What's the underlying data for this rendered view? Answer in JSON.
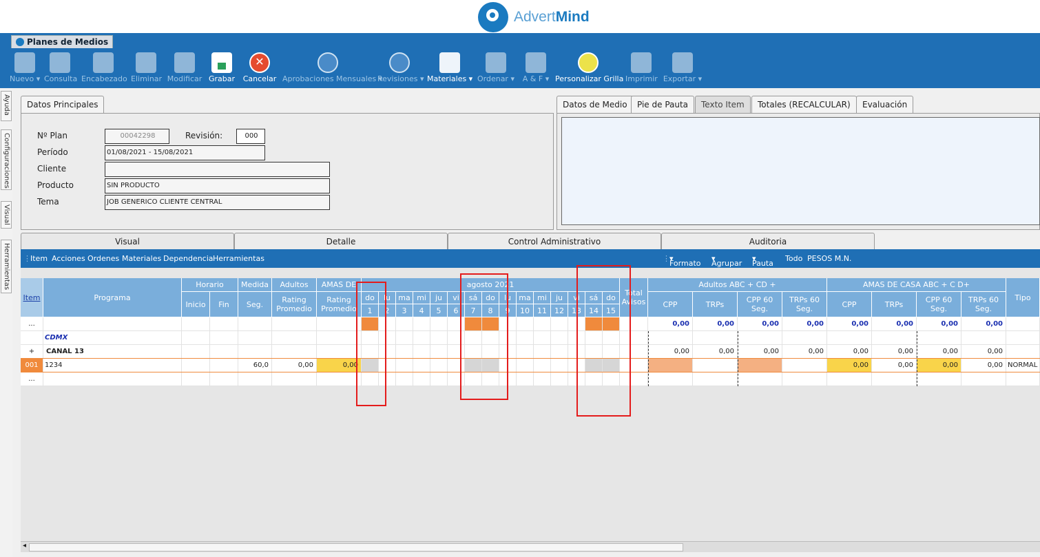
{
  "brand": {
    "name_light": "Advert",
    "name_bold": "Mind"
  },
  "module_tab": "Planes de Medios",
  "toolbar": [
    {
      "label": "Nuevo",
      "dropdown": true,
      "enabled": false,
      "icon": "new-doc-icon"
    },
    {
      "label": "Consulta",
      "dropdown": false,
      "enabled": false,
      "icon": "query-doc-icon"
    },
    {
      "label": "Encabezado",
      "dropdown": false,
      "enabled": false,
      "icon": "edit-doc-icon"
    },
    {
      "label": "Eliminar",
      "dropdown": false,
      "enabled": false,
      "icon": "delete-doc-icon"
    },
    {
      "label": "Modificar",
      "dropdown": false,
      "enabled": false,
      "icon": "modify-doc-icon"
    },
    {
      "label": "Grabar",
      "dropdown": false,
      "enabled": true,
      "icon": "save-icon"
    },
    {
      "label": "Cancelar",
      "dropdown": false,
      "enabled": true,
      "icon": "cancel-icon"
    },
    {
      "label": "Aprobaciones Mensuales",
      "dropdown": true,
      "enabled": false,
      "icon": "thumbs-up-icon"
    },
    {
      "label": "Revisiones",
      "dropdown": true,
      "enabled": false,
      "icon": "thumbs-up-icon"
    },
    {
      "label": "Materiales",
      "dropdown": true,
      "enabled": true,
      "icon": "materials-icon"
    },
    {
      "label": "Ordenar",
      "dropdown": true,
      "enabled": false,
      "icon": "order-doc-icon"
    },
    {
      "label": "A & F",
      "dropdown": true,
      "enabled": false,
      "icon": "af-doc-icon"
    },
    {
      "label": "Personalizar Grilla",
      "dropdown": false,
      "enabled": true,
      "icon": "grid-icon"
    },
    {
      "label": "Imprimir",
      "dropdown": false,
      "enabled": false,
      "icon": "printer-icon"
    },
    {
      "label": "Exportar",
      "dropdown": true,
      "enabled": false,
      "icon": "export-icon"
    }
  ],
  "side_tabs": [
    "Ayuda",
    "Configuraciones",
    "Visual",
    "Herramientas"
  ],
  "datos_principales": {
    "title": "Datos Principales",
    "plan_label": "Nº Plan",
    "plan_value": "00042298",
    "revision_label": "Revisión:",
    "revision_value": "000",
    "periodo_label": "Período",
    "periodo_value": "01/08/2021 - 15/08/2021",
    "cliente_label": "Cliente",
    "cliente_value": "",
    "producto_label": "Producto",
    "producto_value": "SIN PRODUCTO",
    "tema_label": "Tema",
    "tema_value": "JOB GENERICO CLIENTE CENTRAL"
  },
  "right_tabs": [
    "Datos de Medio",
    "Pie de Pauta",
    "Texto Item",
    "Totales (RECALCULAR)",
    "Evaluación"
  ],
  "lower_tabs": [
    "Visual",
    "Detalle",
    "Control Administrativo",
    "Auditoria"
  ],
  "grid_menu_left": [
    "Item",
    "Acciones",
    "Ordenes",
    "Materiales",
    "Dependencia",
    "Herramientas"
  ],
  "grid_menu_right": [
    "Formato",
    "Agrupar",
    "Pauta",
    "Todo",
    "PESOS M.N."
  ],
  "grid": {
    "item_header": "Item",
    "programa_header": "Programa",
    "horario_header": "Horario",
    "inicio_header": "Inicio",
    "fin_header": "Fin",
    "medida_header": "Medida",
    "seg_header": "Seg.",
    "adultos_header": "Adultos",
    "rating_header": "Rating Promedio",
    "amas_header": "AMAS DE",
    "rating2_header": "Rating Promedio",
    "month_header": "agosto 2021",
    "days": [
      {
        "dow": "do",
        "num": "1"
      },
      {
        "dow": "lu",
        "num": "2"
      },
      {
        "dow": "ma",
        "num": "3"
      },
      {
        "dow": "mi",
        "num": "4"
      },
      {
        "dow": "ju",
        "num": "5"
      },
      {
        "dow": "vi",
        "num": "6"
      },
      {
        "dow": "sá",
        "num": "7"
      },
      {
        "dow": "do",
        "num": "8"
      },
      {
        "dow": "lu",
        "num": "9"
      },
      {
        "dow": "ma",
        "num": "10"
      },
      {
        "dow": "mi",
        "num": "11"
      },
      {
        "dow": "ju",
        "num": "12"
      },
      {
        "dow": "vi",
        "num": "13"
      },
      {
        "dow": "sá",
        "num": "14"
      },
      {
        "dow": "do",
        "num": "15"
      }
    ],
    "total_avisos_header": "Total Avisos",
    "group1_header": "Adultos ABC + CD +",
    "group2_header": "AMAS DE CASA ABC + C D+",
    "metric_headers": [
      "CPP",
      "TRPs",
      "CPP 60 Seg.",
      "TRPs 60 Seg."
    ],
    "tipo_header": "Tipo",
    "rows": {
      "summary": {
        "item": "...",
        "metrics": [
          "0,00",
          "0,00",
          "0,00",
          "0,00",
          "0,00",
          "0,00",
          "0,00",
          "0,00"
        ]
      },
      "group": {
        "label": "CDMX"
      },
      "channel": {
        "expander": "+",
        "label": "CANAL 13",
        "metrics": [
          "0,00",
          "0,00",
          "0,00",
          "0,00",
          "0,00",
          "0,00",
          "0,00",
          "0,00"
        ]
      },
      "item": {
        "item": "001",
        "programa": "1234",
        "seg": "60,0",
        "rating": "0,00",
        "rating2": "0,00",
        "metrics": [
          "",
          "",
          "",
          "",
          "0,00",
          "0,00",
          "0,00",
          "0,00"
        ],
        "tipo": "NORMAL"
      },
      "blank": {
        "item": "..."
      }
    }
  }
}
